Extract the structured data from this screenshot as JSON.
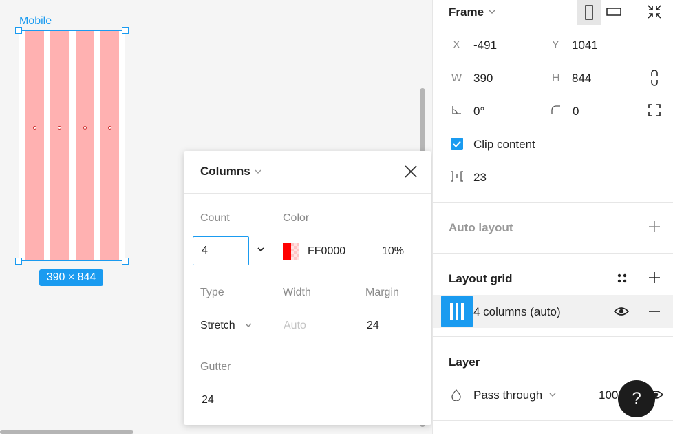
{
  "canvas": {
    "frame_name": "Mobile",
    "frame_size": "390 × 844",
    "column_count": 4
  },
  "popup": {
    "title": "Columns",
    "count_label": "Count",
    "count_value": "4",
    "color_label": "Color",
    "color_hex": "FF0000",
    "opacity": "10%",
    "type_label": "Type",
    "type_value": "Stretch",
    "width_label": "Width",
    "width_placeholder": "Auto",
    "margin_label": "Margin",
    "margin_value": "24",
    "gutter_label": "Gutter",
    "gutter_value": "24"
  },
  "panel": {
    "frame": {
      "title": "Frame",
      "x_label": "X",
      "x_value": "-491",
      "y_label": "Y",
      "y_value": "1041",
      "w_label": "W",
      "w_value": "390",
      "h_label": "H",
      "h_value": "844",
      "rotation": "0°",
      "radius": "0",
      "clip_content": "Clip content",
      "spacing": "23"
    },
    "auto_layout": {
      "title": "Auto layout"
    },
    "layout_grid": {
      "title": "Layout grid",
      "item_label": "4 columns (auto)"
    },
    "layer": {
      "title": "Layer",
      "blend_mode": "Pass through",
      "opacity": "100"
    }
  },
  "help": {
    "label": "?"
  },
  "colors": {
    "accent": "#1a9bf0",
    "grid_column": "#ffb1b1",
    "swatch": "#ff0000"
  },
  "icons": [
    "chevron-down-icon",
    "close-icon",
    "portrait-icon",
    "landscape-icon",
    "collapse-icon",
    "constrain-proportions-icon",
    "rotation-icon",
    "corner-radius-icon",
    "independent-corners-icon",
    "spacing-icon",
    "plus-icon",
    "grid-styles-icon",
    "eye-icon",
    "minus-icon",
    "blend-mode-icon",
    "help-icon",
    "column-grid-icon"
  ]
}
